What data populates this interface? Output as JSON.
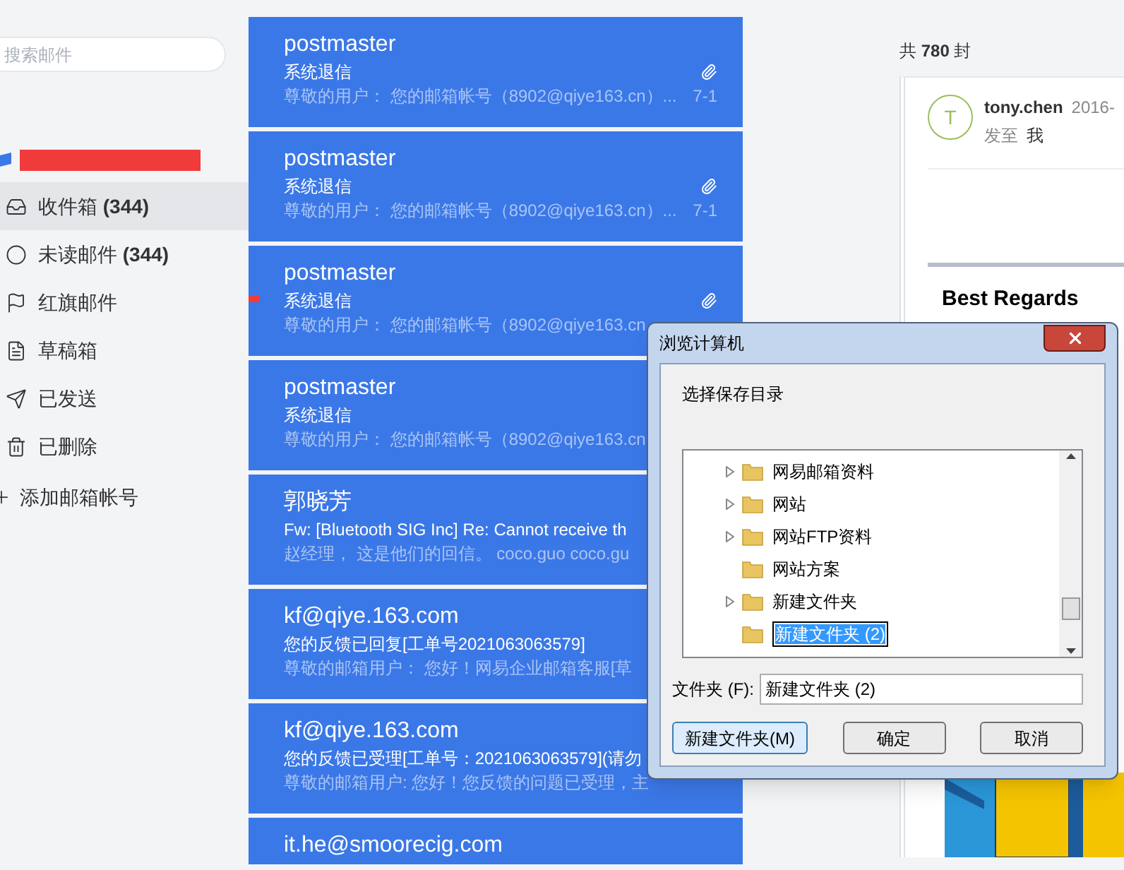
{
  "sidebar": {
    "search": {
      "placeholder": "搜索邮件"
    },
    "folders": [
      {
        "kind": "inbox",
        "label": "收件箱",
        "count": "(344)",
        "selected": true
      },
      {
        "kind": "unread",
        "label": "未读邮件",
        "count": "(344)",
        "selected": false
      },
      {
        "kind": "flag",
        "label": "红旗邮件",
        "selected": false
      },
      {
        "kind": "draft",
        "label": "草稿箱",
        "selected": false
      },
      {
        "kind": "sent",
        "label": "已发送",
        "selected": false
      },
      {
        "kind": "trash",
        "label": "已删除",
        "selected": false
      }
    ],
    "add_account": "添加邮箱帐号"
  },
  "mail_list": [
    {
      "sender": "postmaster",
      "subject": "系统退信",
      "preview": "尊敬的用户： 您的邮箱帐号（8902@qiye163.cn）...",
      "date": "7-1",
      "attachment": true,
      "flagged": false
    },
    {
      "sender": "postmaster",
      "subject": "系统退信",
      "preview": "尊敬的用户： 您的邮箱帐号（8902@qiye163.cn）...",
      "date": "7-1",
      "attachment": true,
      "flagged": false
    },
    {
      "sender": "postmaster",
      "subject": "系统退信",
      "preview": "尊敬的用户： 您的邮箱帐号（8902@qiye163.cn",
      "attachment": true,
      "flagged": true
    },
    {
      "sender": "postmaster",
      "subject": "系统退信",
      "preview": "尊敬的用户： 您的邮箱帐号（8902@qiye163.cn",
      "attachment": false,
      "flagged": false
    },
    {
      "sender": "郭晓芳",
      "subject": "Fw: [Bluetooth SIG Inc] Re: Cannot receive th",
      "preview": "赵经理， 这是他们的回信。 coco.guo coco.gu",
      "attachment": false,
      "flagged": false
    },
    {
      "sender": "kf@qiye.163.com",
      "subject": "您的反馈已回复[工单号2021063063579]",
      "preview": "尊敬的邮箱用户： 您好！网易企业邮箱客服[草",
      "attachment": false,
      "flagged": false
    },
    {
      "sender": "kf@qiye.163.com",
      "subject": "您的反馈已受理[工单号：2021063063579](请勿",
      "preview": "尊敬的邮箱用户: 您好！您反馈的问题已受理，主",
      "attachment": false,
      "flagged": false
    },
    {
      "sender": "it.he@smoorecig.com",
      "attachment": false,
      "flagged": false
    }
  ],
  "reader": {
    "total": "共 **780** 封",
    "avatar": "T",
    "sender": "tony.chen",
    "date": "2016-",
    "to_label": "发至",
    "to": "我",
    "body": "Best Regards"
  },
  "dialog": {
    "title": "浏览计算机",
    "prompt": "选择保存目录",
    "tree": [
      {
        "label": "网易邮箱资料",
        "expandable": true,
        "selected": false
      },
      {
        "label": "网站",
        "expandable": true,
        "selected": false
      },
      {
        "label": "网站FTP资料",
        "expandable": true,
        "selected": false
      },
      {
        "label": "网站方案",
        "expandable": false,
        "selected": false
      },
      {
        "label": "新建文件夹",
        "expandable": true,
        "selected": false
      },
      {
        "label": "新建文件夹 (2)",
        "expandable": false,
        "selected": true
      }
    ],
    "folder_label": "文件夹 (F):",
    "folder_value": "新建文件夹 (2)",
    "buttons": [
      {
        "label": "新建文件夹(M)",
        "default": true
      },
      {
        "label": "确定",
        "default": false
      },
      {
        "label": "取消",
        "default": false
      }
    ]
  }
}
